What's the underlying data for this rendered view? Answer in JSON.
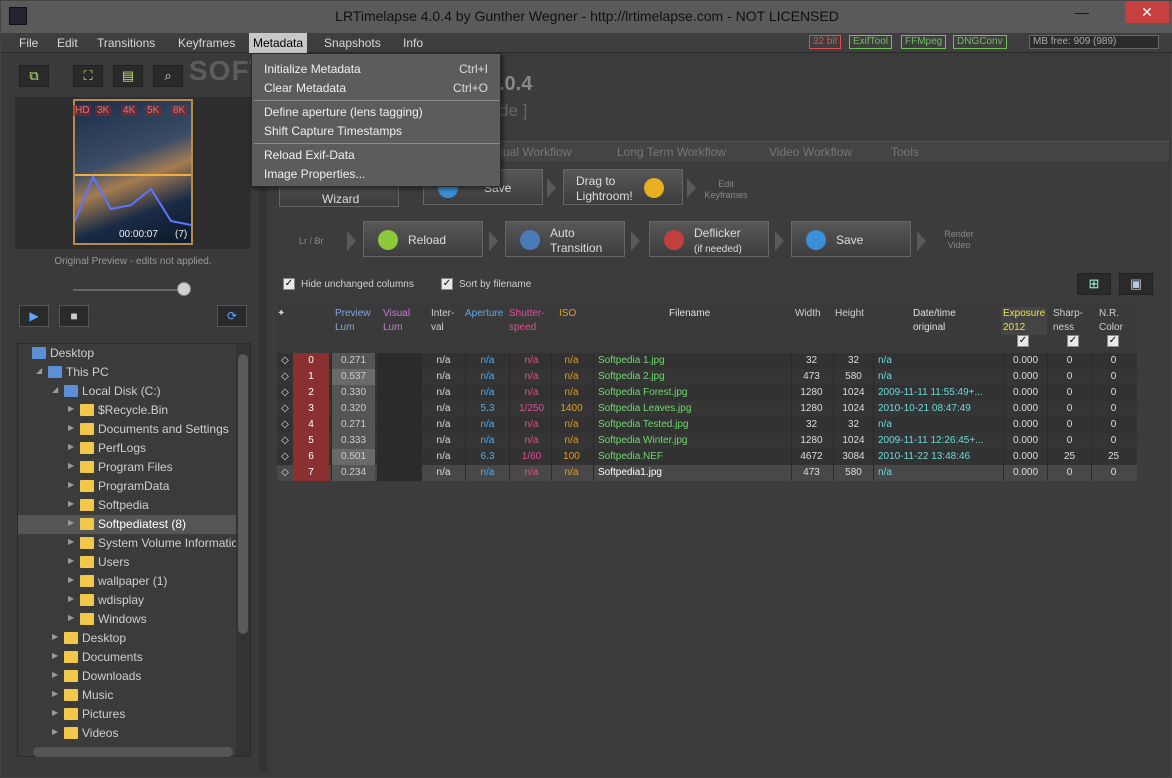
{
  "window": {
    "title": "LRTimelapse 4.0.4 by Gunther Wegner - http://lrtimelapse.com - NOT LICENSED",
    "min": "—",
    "close": "✕"
  },
  "menubar": {
    "items": [
      "File",
      "Edit",
      "Transitions",
      "Keyframes",
      "Metadata",
      "Snapshots",
      "Info"
    ],
    "badges": [
      {
        "label": "32 bit",
        "color": "#e05050"
      },
      {
        "label": "ExifTool",
        "color": "#6fbf5f"
      },
      {
        "label": "FFMpeg",
        "color": "#6fbf5f"
      },
      {
        "label": "DNGConv",
        "color": "#6fbf5f"
      }
    ],
    "memory": "MB free: 909  (989)"
  },
  "watermark": "SOFTPEDIA",
  "metadata_menu": {
    "items": [
      {
        "label": "Initialize Metadata",
        "shortcut": "Ctrl+I"
      },
      {
        "label": "Clear Metadata",
        "shortcut": "Ctrl+O"
      },
      {
        "label": "Define aperture (lens tagging)",
        "shortcut": ""
      },
      {
        "label": "Shift Capture Timestamps",
        "shortcut": ""
      },
      {
        "label": "Reload Exif-Data",
        "shortcut": ""
      },
      {
        "label": "Image Properties...",
        "shortcut": ""
      }
    ]
  },
  "preview": {
    "res": [
      "HD",
      "3K",
      "4K",
      "5K",
      "8K"
    ],
    "time": "00:00:07",
    "count": "(7)",
    "caption": "Original Preview - edits not applied."
  },
  "tree": [
    {
      "label": "Desktop",
      "level": 0,
      "type": "pc",
      "arrow": ""
    },
    {
      "label": "This PC",
      "level": 1,
      "type": "pc",
      "arrow": "◢"
    },
    {
      "label": "Local Disk (C:)",
      "level": 2,
      "type": "pc",
      "arrow": "◢"
    },
    {
      "label": "$Recycle.Bin",
      "level": 3,
      "type": "folder",
      "arrow": "▶"
    },
    {
      "label": "Documents and Settings",
      "level": 3,
      "type": "folder",
      "arrow": "▶"
    },
    {
      "label": "PerfLogs",
      "level": 3,
      "type": "folder",
      "arrow": "▶"
    },
    {
      "label": "Program Files",
      "level": 3,
      "type": "folder",
      "arrow": "▶"
    },
    {
      "label": "ProgramData",
      "level": 3,
      "type": "folder",
      "arrow": "▶"
    },
    {
      "label": "Softpedia",
      "level": 3,
      "type": "folder",
      "arrow": "▶"
    },
    {
      "label": "Softpediatest (8)",
      "level": 3,
      "type": "folder",
      "arrow": "▶",
      "sel": true
    },
    {
      "label": "System Volume Information",
      "level": 3,
      "type": "folder",
      "arrow": "▶"
    },
    {
      "label": "Users",
      "level": 3,
      "type": "folder",
      "arrow": "▶"
    },
    {
      "label": "wallpaper (1)",
      "level": 3,
      "type": "folder",
      "arrow": "▶"
    },
    {
      "label": "wdisplay",
      "level": 3,
      "type": "folder",
      "arrow": "▶"
    },
    {
      "label": "Windows",
      "level": 3,
      "type": "folder",
      "arrow": "▶"
    },
    {
      "label": "Desktop",
      "level": 2,
      "type": "folder",
      "arrow": "▶"
    },
    {
      "label": "Documents",
      "level": 2,
      "type": "folder",
      "arrow": "▶"
    },
    {
      "label": "Downloads",
      "level": 2,
      "type": "folder",
      "arrow": "▶"
    },
    {
      "label": "Music",
      "level": 2,
      "type": "folder",
      "arrow": "▶"
    },
    {
      "label": "Pictures",
      "level": 2,
      "type": "folder",
      "arrow": "▶"
    },
    {
      "label": "Videos",
      "level": 2,
      "type": "folder",
      "arrow": "▶"
    }
  ],
  "header": {
    "version": ".0.4",
    "mode": "de ]"
  },
  "tabs": [
    "sual Workflow",
    "Long Term Workflow",
    "Video Workflow",
    "Tools"
  ],
  "workflow": {
    "wizard": "Wizard",
    "save": "Save",
    "drag1": "Drag to",
    "drag2": "Lightroom!",
    "edit_keyframes": "Edit\nKeyframes",
    "lrbr": "Lr / Br",
    "reload": "Reload",
    "auto1": "Auto",
    "auto2": "Transition",
    "defl1": "Deflicker",
    "defl2": "(if needed)",
    "save2": "Save",
    "render": "Render\nVideo"
  },
  "options": {
    "hide": "Hide unchanged columns",
    "sort": "Sort by filename"
  },
  "table": {
    "headers": [
      {
        "k": "idx",
        "label": "✦",
        "color": "#cfcfcf"
      },
      {
        "k": "lum",
        "label": "Preview\nLum",
        "color": "#7ea6e0"
      },
      {
        "k": "vis",
        "label": "Visual\nLum",
        "color": "#c878d8"
      },
      {
        "k": "int",
        "label": "Inter-\nval",
        "color": "#cfcfcf"
      },
      {
        "k": "ap",
        "label": "Aperture",
        "color": "#5aa8e8"
      },
      {
        "k": "sh",
        "label": "Shutter-\nspeed",
        "color": "#e0508a"
      },
      {
        "k": "iso",
        "label": "ISO",
        "color": "#e0a020"
      },
      {
        "k": "fn",
        "label": "Filename",
        "color": "#e0e0e0"
      },
      {
        "k": "w",
        "label": "Width",
        "color": "#cfcfcf"
      },
      {
        "k": "h",
        "label": "Height",
        "color": "#cfcfcf"
      },
      {
        "k": "dt",
        "label": "Date/time\noriginal",
        "color": "#e0e0e0"
      },
      {
        "k": "ex",
        "label": "Exposure\n2012",
        "color": "#f0e040"
      },
      {
        "k": "shp",
        "label": "Sharp-\nness",
        "color": "#cfcfcf"
      },
      {
        "k": "nr",
        "label": "N.R.\nColor",
        "color": "#cfcfcf"
      }
    ],
    "rows": [
      [
        "0",
        "0.271",
        "n/a",
        "n/a",
        "n/a",
        "n/a",
        "Softpedia 1.jpg",
        "32",
        "32",
        "n/a",
        "0.000",
        "0",
        "0"
      ],
      [
        "1",
        "0.537",
        "n/a",
        "n/a",
        "n/a",
        "n/a",
        "Softpedia 2.jpg",
        "473",
        "580",
        "n/a",
        "0.000",
        "0",
        "0"
      ],
      [
        "2",
        "0.330",
        "n/a",
        "n/a",
        "n/a",
        "n/a",
        "Softpedia Forest.jpg",
        "1280",
        "1024",
        "2009-11-11 11:55:49+...",
        "0.000",
        "0",
        "0"
      ],
      [
        "3",
        "0.320",
        "n/a",
        "5.3",
        "1/250",
        "1400",
        "Softpedia Leaves.jpg",
        "1280",
        "1024",
        "2010-10-21 08:47:49",
        "0.000",
        "0",
        "0"
      ],
      [
        "4",
        "0.271",
        "n/a",
        "n/a",
        "n/a",
        "n/a",
        "Softpedia Tested.jpg",
        "32",
        "32",
        "n/a",
        "0.000",
        "0",
        "0"
      ],
      [
        "5",
        "0.333",
        "n/a",
        "n/a",
        "n/a",
        "n/a",
        "Softpedia Winter.jpg",
        "1280",
        "1024",
        "2009-11-11 12:26:45+...",
        "0.000",
        "0",
        "0"
      ],
      [
        "6",
        "0.501",
        "n/a",
        "6.3",
        "1/60",
        "100",
        "Softpedia.NEF",
        "4672",
        "3084",
        "2010-11-22 13:48:46",
        "0.000",
        "25",
        "25"
      ],
      [
        "7",
        "0.234",
        "n/a",
        "n/a",
        "n/a",
        "n/a",
        "Softpedia1.jpg",
        "473",
        "580",
        "n/a",
        "0.000",
        "0",
        "0"
      ]
    ]
  }
}
